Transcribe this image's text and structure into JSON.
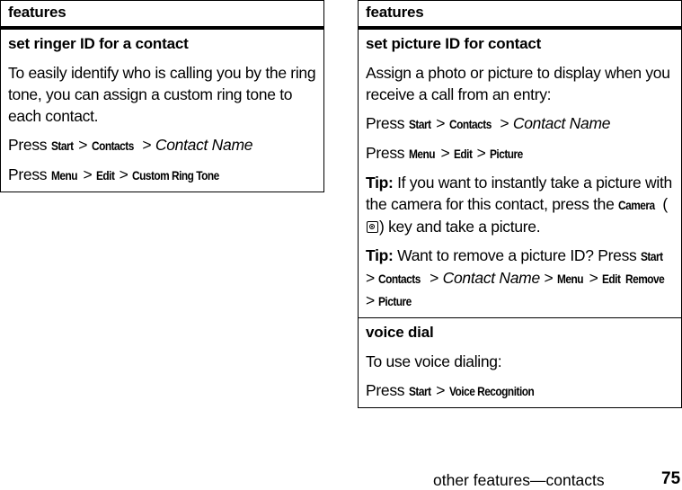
{
  "left_table": {
    "header": "features",
    "sections": [
      {
        "title": "set ringer ID for a contact",
        "description": "To easily identify who is calling you by the ring tone, you can assign a custom ring tone to each contact.",
        "steps": [
          {
            "prefix": "Press",
            "path": [
              "Start",
              "Contacts"
            ],
            "italic": "Contact Name"
          },
          {
            "prefix": "Press",
            "path": [
              "Menu",
              "Edit",
              "Custom Ring Tone"
            ]
          }
        ]
      }
    ]
  },
  "right_table": {
    "header": "features",
    "sections": [
      {
        "title": "set picture ID for contact",
        "description": "Assign a photo or picture to display when you receive a call from an entry:",
        "step1": {
          "prefix": "Press",
          "k1": "Start",
          "k2": "Contacts",
          "italic": "Contact Name"
        },
        "step2": {
          "prefix": "Press",
          "k1": "Menu",
          "k2": "Edit",
          "k3": "Picture"
        },
        "tip1": {
          "label": "Tip:",
          "text1": "If you want to instantly take a picture with the camera for this contact, press the",
          "key": "Camera",
          "icon": "camera-icon",
          "text2": "key and take a picture."
        },
        "tip2": {
          "label": "Tip:",
          "text1": "Want to remove a picture ID? Press",
          "k1": "Start",
          "k2": "Contacts",
          "italic": "Contact Name",
          "k3": "Menu",
          "k4": "Edit",
          "k5": "Remove",
          "k6": "Picture"
        }
      },
      {
        "title": "voice dial",
        "description": "To use voice dialing:",
        "step1": {
          "prefix": "Press",
          "k1": "Start",
          "k2": "Voice Recognition"
        }
      }
    ]
  },
  "footer": {
    "section_title": "other features—contacts",
    "page_number": "75"
  },
  "separator": ">"
}
